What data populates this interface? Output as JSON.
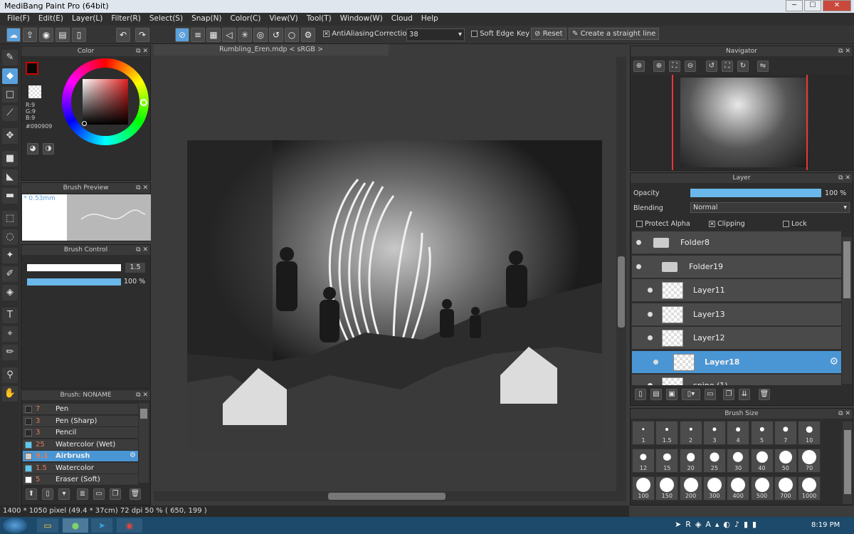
{
  "window": {
    "title": "MediBang Paint Pro (64bit)",
    "minimize": "─",
    "maximize": "☐",
    "close": "✕"
  },
  "menu": [
    "File(F)",
    "Edit(E)",
    "Layer(L)",
    "Filter(R)",
    "Select(S)",
    "Snap(N)",
    "Color(C)",
    "View(V)",
    "Tool(T)",
    "Window(W)",
    "Cloud",
    "Help"
  ],
  "toolbar": {
    "antialiasing_label": "AntiAliasing",
    "correction_label": "Correction",
    "correction_value": "38",
    "soft_edge_label": "Soft Edge",
    "key_label": "Key",
    "reset_label": "Reset",
    "straight_line_label": "Create a straight line"
  },
  "color_panel": {
    "title": "Color",
    "r": "R:9",
    "g": "G:9",
    "b": "B:9",
    "hex": "#090909",
    "fg_color": "#090909"
  },
  "brush_preview": {
    "title": "Brush Preview",
    "size": "* 0.53mm"
  },
  "brush_control": {
    "title": "Brush Control",
    "size_value": "1.5",
    "opacity_value": "100 %",
    "opacity_fraction": 1.0
  },
  "brush_list": {
    "title": "Brush: NONAME",
    "items": [
      {
        "size": "7",
        "name": "Pen",
        "color": "#2a2a2a"
      },
      {
        "size": "3",
        "name": "Pen (Sharp)",
        "color": "#2a2a2a"
      },
      {
        "size": "3",
        "name": "Pencil",
        "color": "#2a2a2a"
      },
      {
        "size": "25",
        "name": "Watercolor (Wet)",
        "color": "#5bc8f0"
      },
      {
        "size": "9.1",
        "name": "Airbrush",
        "color": "#cfcfcf"
      },
      {
        "size": "1.5",
        "name": "Watercolor",
        "color": "#5bc8f0"
      },
      {
        "size": "5",
        "name": "Eraser (Soft)",
        "color": "#ffffff"
      }
    ],
    "selected_index": 4
  },
  "document": {
    "tab": "Rumbling_Eren.mdp < sRGB >"
  },
  "navigator": {
    "title": "Navigator"
  },
  "layer_panel": {
    "title": "Layer",
    "opacity_label": "Opacity",
    "opacity_value": "100 %",
    "opacity_fraction": 1.0,
    "blending_label": "Blending",
    "blending_value": "Normal",
    "protect_alpha": "Protect Alpha",
    "clipping": "Clipping",
    "lock": "Lock",
    "layers": [
      {
        "name": "Folder8",
        "type": "folder"
      },
      {
        "name": "Folder19",
        "type": "folder"
      },
      {
        "name": "Layer11",
        "type": "layer"
      },
      {
        "name": "Layer13",
        "type": "layer"
      },
      {
        "name": "Layer12",
        "type": "layer"
      },
      {
        "name": "Layer18",
        "type": "layer",
        "selected": true
      },
      {
        "name": "spine (1)",
        "type": "layer"
      }
    ]
  },
  "brush_size": {
    "title": "Brush Size",
    "sizes": [
      "1",
      "1.5",
      "2",
      "3",
      "4",
      "5",
      "7",
      "10",
      "12",
      "15",
      "20",
      "25",
      "30",
      "40",
      "50",
      "70",
      "100",
      "150",
      "200",
      "300",
      "400",
      "500",
      "700",
      "1000"
    ]
  },
  "status": "1400 * 1050 pixel  (49.4 * 37cm)  72 dpi  50 %  ( 650, 199 )",
  "taskbar": {
    "time": "8:19 PM"
  }
}
